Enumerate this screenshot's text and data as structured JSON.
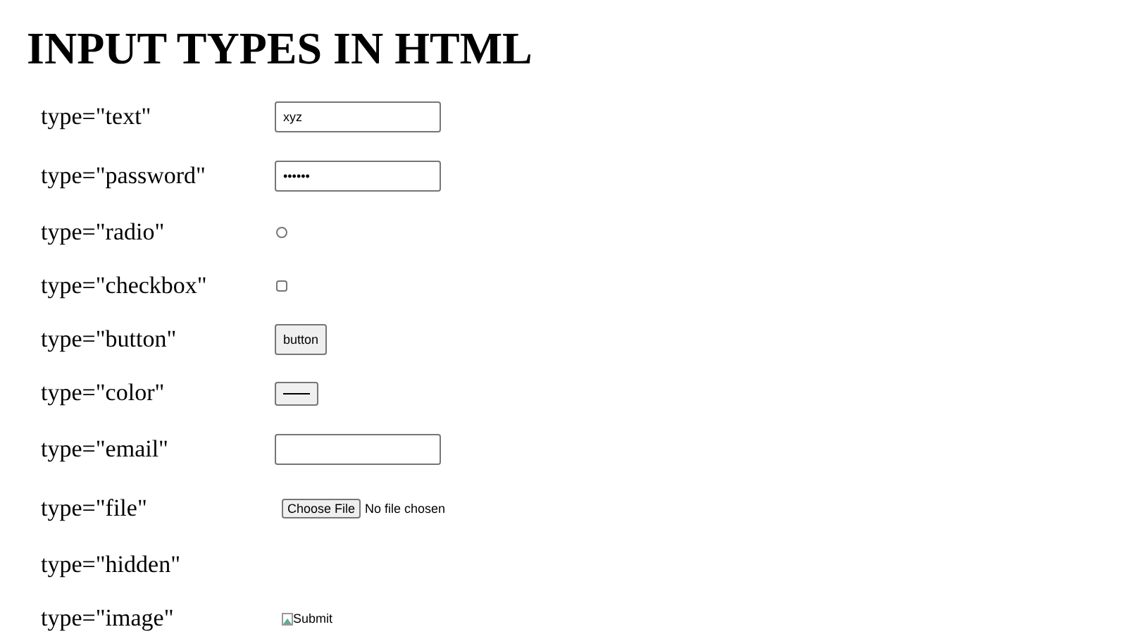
{
  "title": "INPUT TYPES IN HTML",
  "rows": [
    {
      "label": "type=\"text\"",
      "kind": "text",
      "value": "xyz"
    },
    {
      "label": "type=\"password\"",
      "kind": "password",
      "value": "••••••"
    },
    {
      "label": "type=\"radio\"",
      "kind": "radio",
      "checked": false
    },
    {
      "label": "type=\"checkbox\"",
      "kind": "checkbox",
      "checked": false
    },
    {
      "label": "type=\"button\"",
      "kind": "button",
      "value": "button"
    },
    {
      "label": "type=\"color\"",
      "kind": "color",
      "color": "#000000"
    },
    {
      "label": "type=\"email\"",
      "kind": "email"
    },
    {
      "label": "type=\"file\"",
      "kind": "file",
      "button": "Choose File",
      "status": "No file chosen"
    },
    {
      "label": "type=\"hidden\"",
      "kind": "hidden"
    },
    {
      "label": "type=\"image\"",
      "kind": "image",
      "alt": "Submit"
    }
  ]
}
